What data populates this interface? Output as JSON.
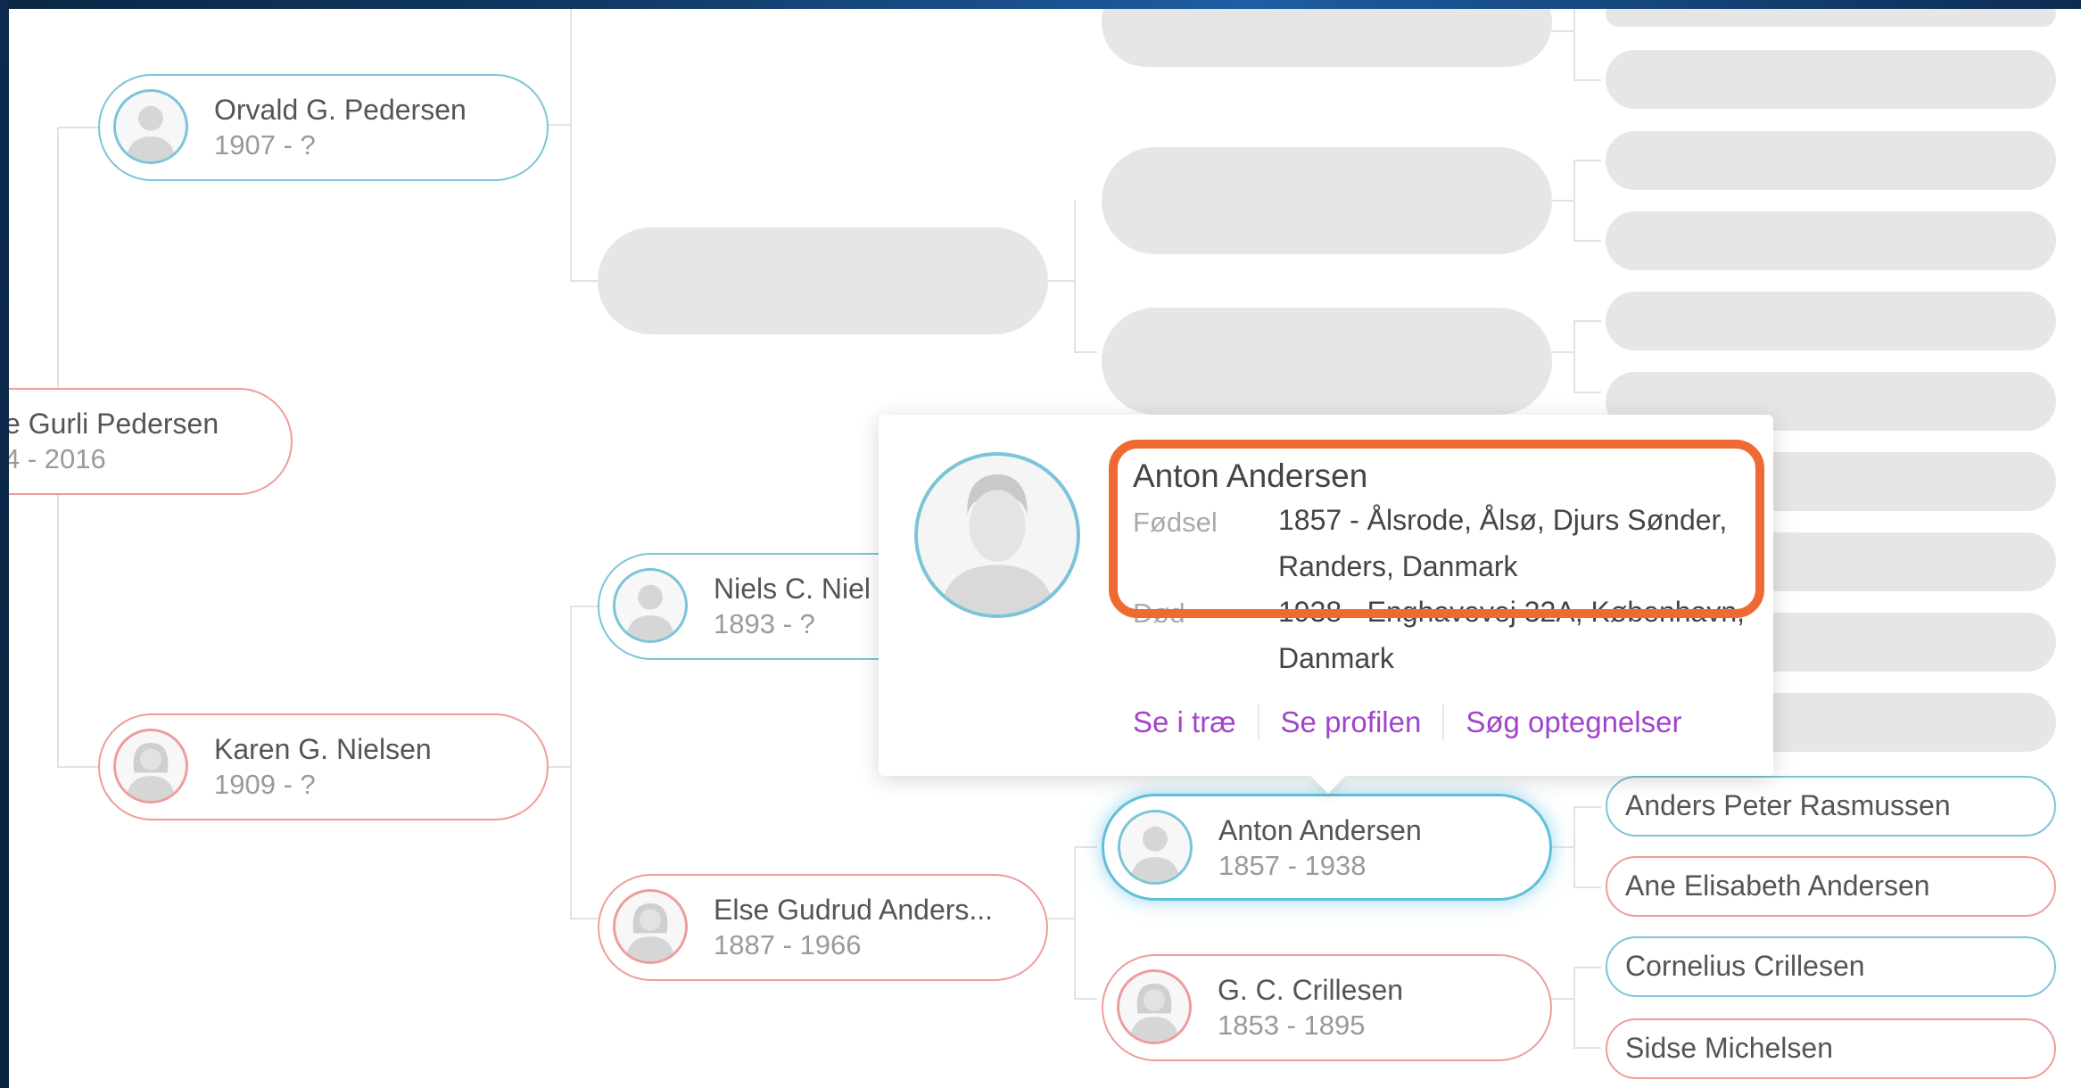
{
  "people": {
    "orvald": {
      "name": "Orvald G. Pedersen",
      "dates": "1907 - ?"
    },
    "gurli": {
      "name": "e Gurli Pedersen",
      "dates": "4 - 2016"
    },
    "niels": {
      "name": "Niels C. Niel",
      "dates": "1893 - ?"
    },
    "karen": {
      "name": "Karen G. Nielsen",
      "dates": "1909 - ?"
    },
    "else": {
      "name": "Else Gudrud Anders...",
      "dates": "1887 - 1966"
    },
    "anton": {
      "name": "Anton Andersen",
      "dates": "1857 - 1938"
    },
    "crillesen": {
      "name": "G. C. Crillesen",
      "dates": "1853 - 1895"
    }
  },
  "ancestors": {
    "anders_peter": "Anders Peter Rasmussen",
    "ane_elisabeth": "Ane Elisabeth Andersen",
    "cornelius": "Cornelius Crillesen",
    "sidse": "Sidse Michelsen"
  },
  "popup": {
    "name": "Anton Andersen",
    "birth_label": "Fødsel",
    "birth_value": "1857 - Ålsrode, Ålsø, Djurs Sønder, Randers, Danmark",
    "death_label": "Død",
    "death_value": "1938 - Enghavevej 32A, København, Danmark",
    "links": {
      "view_tree": "Se i træ",
      "view_profile": "Se profilen",
      "search_records": "Søg optegnelser"
    }
  },
  "colors": {
    "male_border": "#7cc4d8",
    "female_border": "#ee9d9d",
    "link": "#a045c8",
    "highlight": "#ef6a33",
    "placeholder": "#e6e6e6"
  }
}
